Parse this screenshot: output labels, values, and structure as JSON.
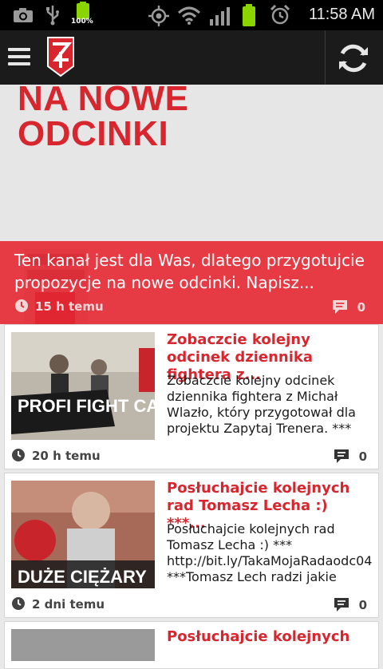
{
  "status_bar": {
    "time": "11:58 AM",
    "battery_label": "100%",
    "icons": [
      "camera-icon",
      "usb-icon",
      "battery-charging-icon",
      "gps-icon",
      "wifi-icon",
      "signal-icon",
      "battery-icon",
      "alarm-icon"
    ]
  },
  "app_bar": {
    "menu_icon": "hamburger-icon",
    "logo_icon": "zapytaj-trenera-logo",
    "refresh_icon": "refresh-icon"
  },
  "hero": {
    "banner_line1": "NA NOWE",
    "banner_line2": "ODCINKI",
    "title": "Ten kanał jest dla Was, dlatego przygotujcie propozycje na nowe odcinki. Napisz...",
    "time": "15 h temu",
    "comments": "0"
  },
  "posts": [
    {
      "title": "Zobaczcie kolejny odcinek dziennika fightera z...",
      "body": "Zobaczcie kolejny odcinek dziennika fightera z Michał Wlazło, który przygotował dla projektu Zapytaj Trenera. ***",
      "thumb_caption": "PROFI FIGHT CAMP",
      "time": "20 h temu",
      "comments": "0"
    },
    {
      "title": "Posłuchajcie kolejnych rad Tomasz Lecha :) ***...",
      "body": "Posłuchajcie kolejnych rad Tomasz Lecha :) *** http://bit.ly/TakaMojaRadaodc04 ***Tomasz Lech radzi jakie",
      "thumb_caption": "DUŻE CIĘŻARY",
      "time": "2 dni temu",
      "comments": "0"
    },
    {
      "title": "Posłuchajcie kolejnych",
      "body": "",
      "thumb_caption": "",
      "time": "",
      "comments": ""
    }
  ],
  "colors": {
    "accent_red": "#d8262e",
    "app_bar": "#1b1b1b",
    "status_bar": "#000000",
    "list_bg": "#e9e9e9"
  }
}
